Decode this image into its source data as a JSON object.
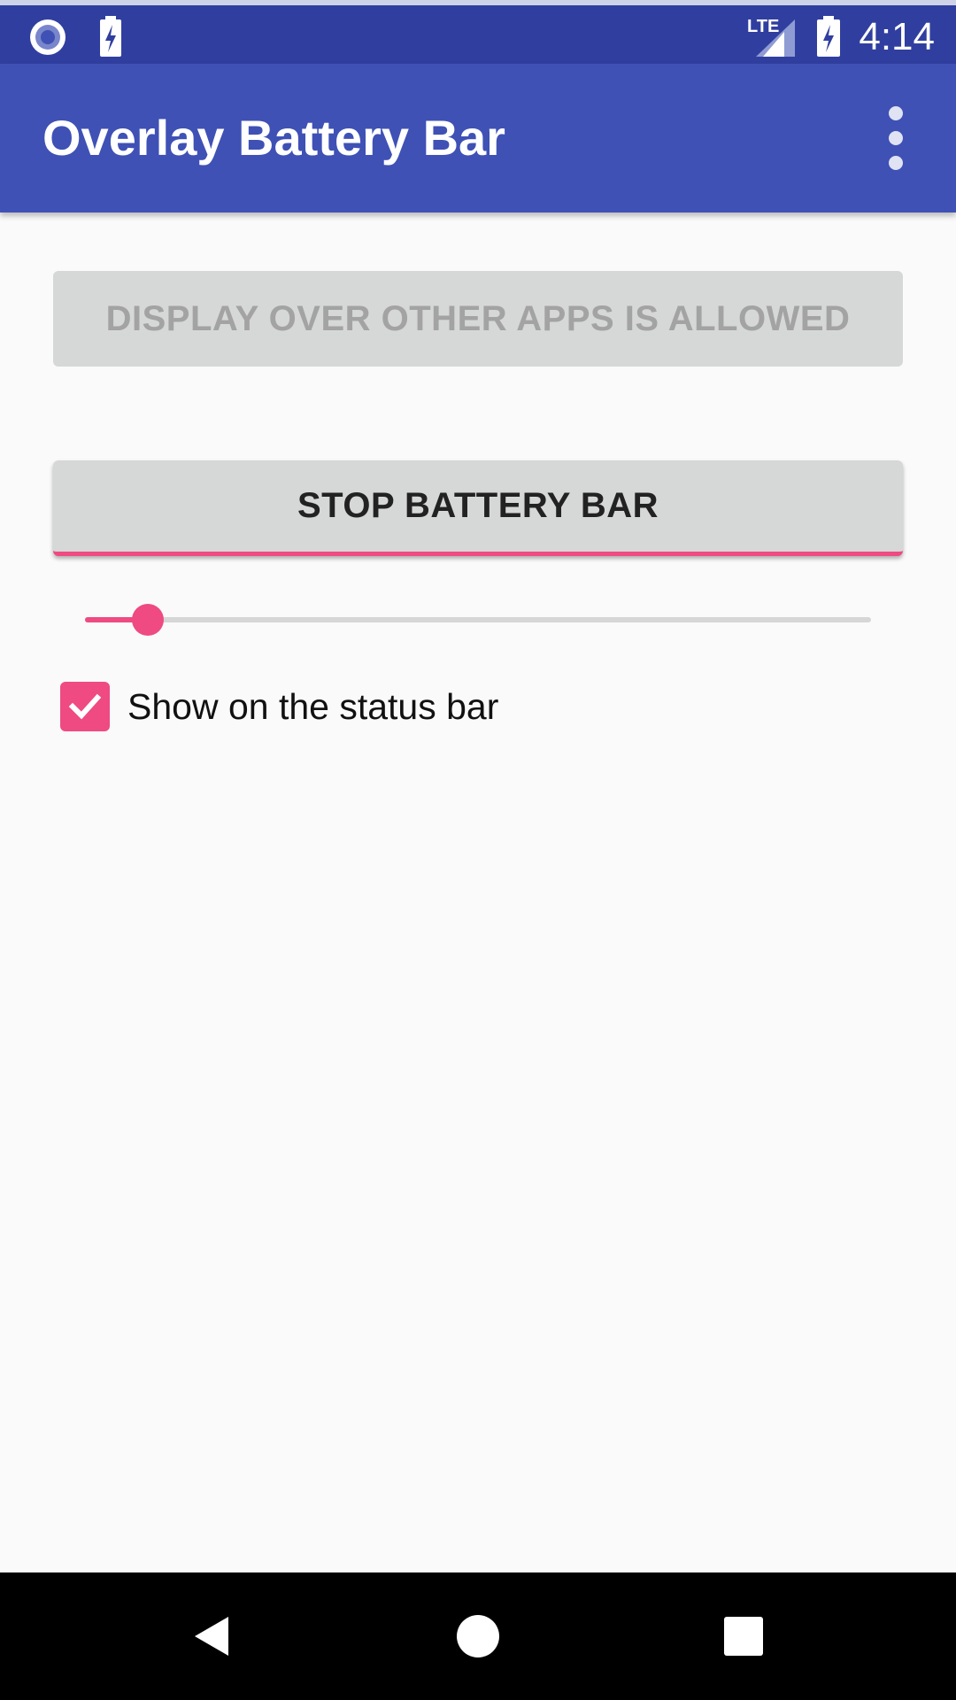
{
  "status_bar": {
    "time": "4:14",
    "network_label": "LTE",
    "icons": [
      "notification-dot-icon",
      "battery-charging-icon",
      "lte-signal-icon",
      "battery-charging-icon"
    ]
  },
  "app_bar": {
    "title": "Overlay Battery Bar",
    "menu_icon": "more-vert-icon"
  },
  "buttons": {
    "overlay_permission_label": "DISPLAY OVER OTHER APPS IS ALLOWED",
    "stop_battery_bar_label": "STOP BATTERY BAR"
  },
  "slider": {
    "value_fraction": 0.08
  },
  "status_bar_option": {
    "label": "Show on the status bar",
    "checked": true
  },
  "nav_bar": {
    "icons": [
      "back-icon",
      "home-icon",
      "recents-icon"
    ]
  },
  "colors": {
    "primary": "#3f51b5",
    "primary_dark": "#303f9f",
    "accent": "#ef4a82"
  }
}
